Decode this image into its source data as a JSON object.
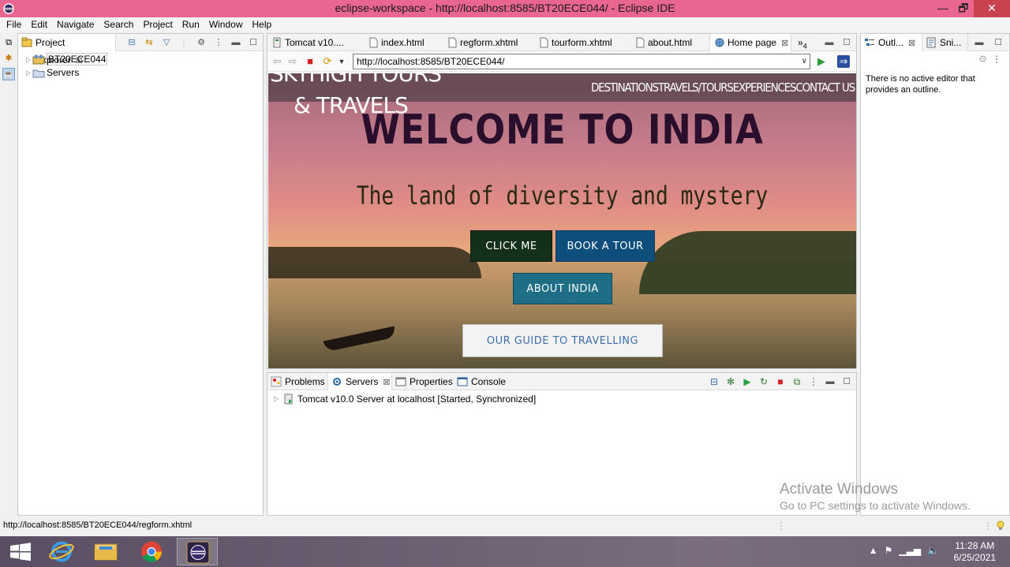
{
  "window": {
    "title": "eclipse-workspace - http://localhost:8585/BT20ECE044/ - Eclipse IDE",
    "minimize": "—",
    "restore": "🗗",
    "close": "✕"
  },
  "menu": [
    "File",
    "Edit",
    "Navigate",
    "Search",
    "Project",
    "Run",
    "Window",
    "Help"
  ],
  "explorer": {
    "tab_label": "Project Explorer",
    "items": [
      {
        "label": "BT20ECE044",
        "icon": "project-icon"
      },
      {
        "label": "Servers",
        "icon": "folder-icon"
      }
    ]
  },
  "editor": {
    "tabs": [
      {
        "label": "Tomcat v10....",
        "icon": "server-config-icon"
      },
      {
        "label": "index.html",
        "icon": "file-icon"
      },
      {
        "label": "regform.xhtml",
        "icon": "file-icon"
      },
      {
        "label": "tourform.xhtml",
        "icon": "file-icon"
      },
      {
        "label": "about.html",
        "icon": "file-icon"
      },
      {
        "label": "Home page",
        "icon": "globe-icon",
        "active": true
      }
    ],
    "overflow_count": "4",
    "url": "http://localhost:8585/BT20ECE044/"
  },
  "webpage": {
    "brand_line1": "SKYHIGH TOURS",
    "brand_line2": "& TRAVELS",
    "nav": [
      "DESTINATIONS",
      "TRAVELS/TOURS",
      "EXPERIENCES",
      "CONTACT US"
    ],
    "hero_title": "WELCOME TO INDIA",
    "hero_subtitle": "The land of diversity and mystery",
    "buttons": {
      "click_me": "CLICK ME",
      "book_tour": "BOOK A TOUR",
      "about_india": "ABOUT INDIA",
      "guide": "OUR GUIDE TO TRAVELLING"
    },
    "colors": {
      "click_me": "#14301a",
      "book_tour": "#0e4e7c",
      "about_india": "#1e6f86",
      "guide_bg": "#f3f3f3",
      "guide_text": "#3d6fb0",
      "title": "#2a0f2c"
    }
  },
  "bottom_panel": {
    "tabs": [
      "Problems",
      "Servers",
      "Properties",
      "Console"
    ],
    "active_tab": "Servers",
    "server_row": "Tomcat v10.0 Server at localhost  [Started, Synchronized]"
  },
  "outline": {
    "tabs": [
      "Outl...",
      "Sni..."
    ],
    "message": "There is no active editor that provides an outline."
  },
  "watermark": {
    "line1": "Activate Windows",
    "line2": "Go to PC settings to activate Windows."
  },
  "status": {
    "text": "http://localhost:8585/BT20ECE044/regform.xhtml"
  },
  "taskbar": {
    "time": "11:28 AM",
    "date": "6/25/2021",
    "apps": [
      "start-icon",
      "internet-explorer-icon",
      "file-explorer-icon",
      "chrome-icon",
      "eclipse-icon"
    ]
  }
}
